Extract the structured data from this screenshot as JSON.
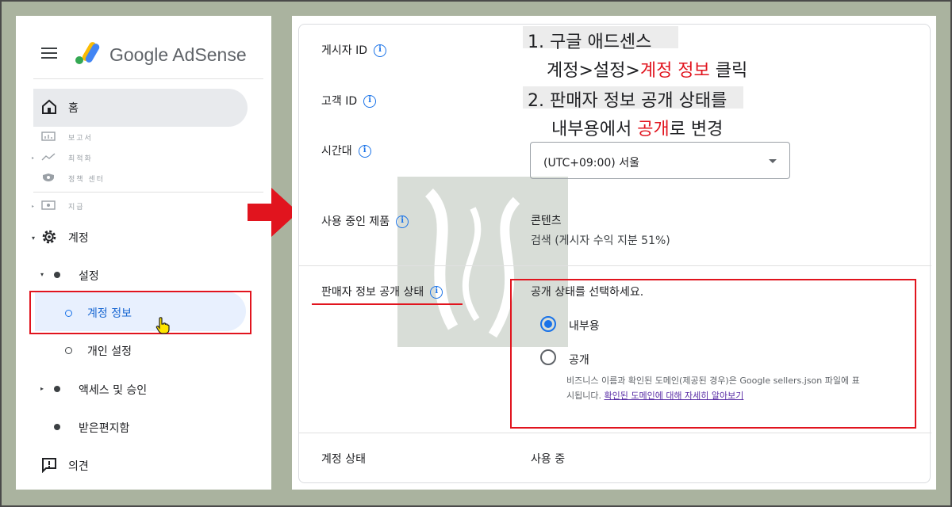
{
  "sidebar": {
    "brand": "Google AdSense",
    "home": "홈",
    "faded_items": [
      "보고서",
      "최적화",
      "정책 센터",
      "지급"
    ],
    "account": "계정",
    "settings": "설정",
    "account_info": "계정 정보",
    "personal_settings": "개인 설정",
    "access": "액세스 및 승인",
    "inbox": "받은편지함",
    "feedback": "의견"
  },
  "details": {
    "publisher_id_label": "게시자 ID",
    "customer_id_label": "고객 ID",
    "timezone_label": "시간대",
    "timezone_value": "(UTC+09:00) 서울",
    "products_label": "사용 중인 제품",
    "products_line1": "콘텐츠",
    "products_line2": "검색 (게시자 수익 지분 51%)",
    "seller_label": "판매자 정보 공개 상태",
    "seller_prompt": "공개 상태를 선택하세요.",
    "option_internal": "내부용",
    "option_public": "공개",
    "help_line1": "비즈니스 이름과 확인된 도메인(제공된 경우)은 Google sellers.json 파일에 표",
    "help_line2_prefix": "시됩니다. ",
    "help_link": "확인된 도메인에 대해 자세히 알아보기",
    "status_label": "계정 상태",
    "status_value": "사용 중"
  },
  "annotations": {
    "line1": "1. 구글 애드센스",
    "line2_prefix": "계정>설정>",
    "line2_red": "계정 정보",
    "line2_suffix": " 클릭",
    "line3": "2. 판매자 정보 공개 상태를",
    "line4_prefix": "내부용에서 ",
    "line4_red": "공개",
    "line4_suffix": "로 변경"
  },
  "colors": {
    "accent": "#1a73e8",
    "highlight_red": "#e1141e",
    "background": "#aab39f"
  }
}
